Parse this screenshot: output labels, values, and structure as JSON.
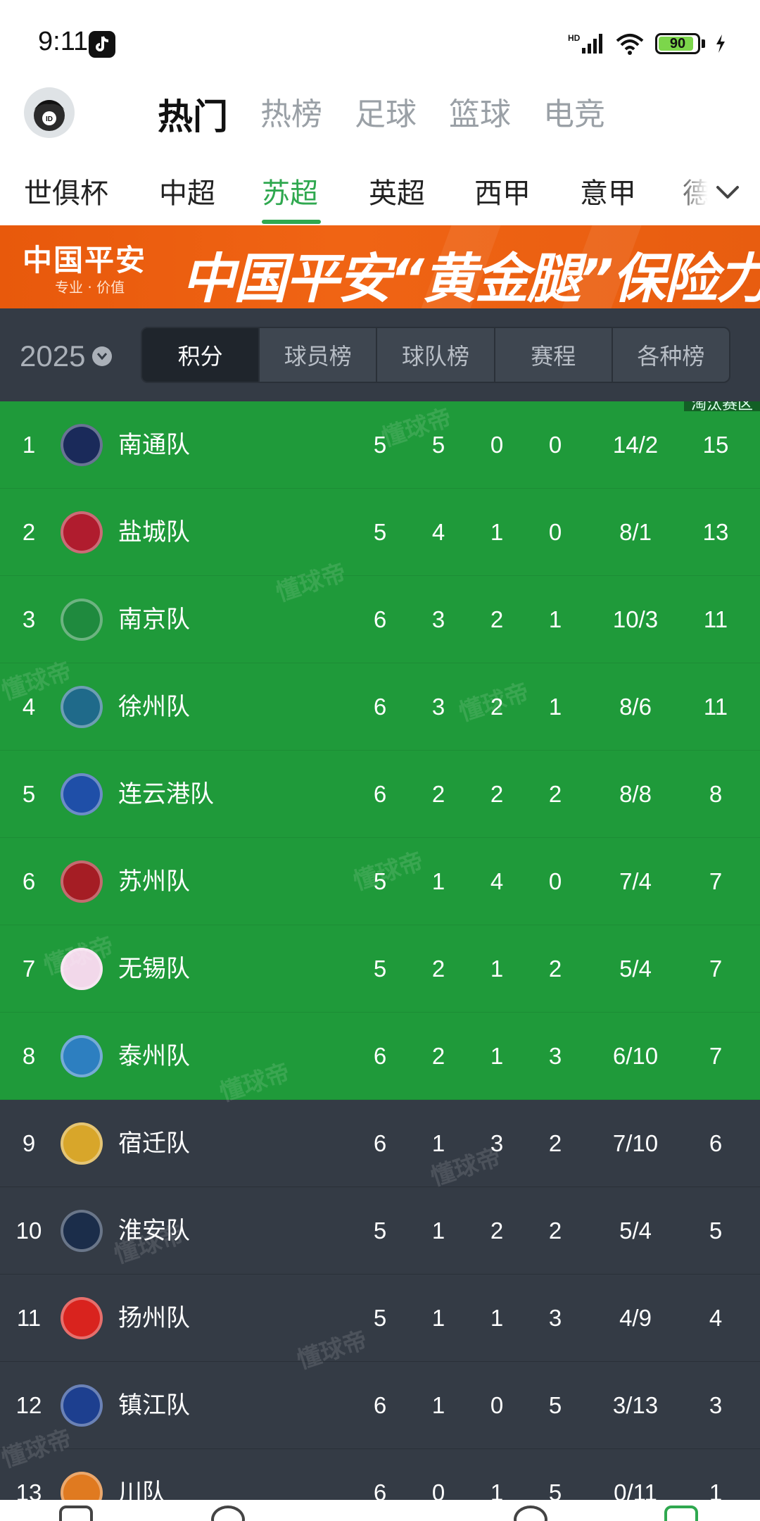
{
  "status_bar": {
    "time": "9:11",
    "battery": "90",
    "battery_level": 0.9
  },
  "top_nav": {
    "tabs": [
      "热门",
      "热榜",
      "足球",
      "篮球",
      "电竞"
    ],
    "active_index": 0
  },
  "league_tabs": {
    "items": [
      "世俱杯",
      "中超",
      "苏超",
      "英超",
      "西甲",
      "意甲",
      "德"
    ],
    "active_index": 2
  },
  "banner": {
    "brand": "中国平安",
    "sub": "专业 · 价值",
    "slogan": "中国平安“黄金腿”保险力挺苏超"
  },
  "filter": {
    "year": "2025",
    "segments": [
      "积分",
      "球员榜",
      "球队榜",
      "赛程",
      "各种榜"
    ],
    "active_index": 0
  },
  "zone_tag": "淘汰赛区",
  "watermark": "懂球帝",
  "standings": [
    {
      "rank": "1",
      "team": "南通队",
      "played": "5",
      "win": "5",
      "draw": "0",
      "loss": "0",
      "goals": "14/2",
      "points": "15",
      "zone": "green",
      "logo_color": "#1a2a5a"
    },
    {
      "rank": "2",
      "team": "盐城队",
      "played": "5",
      "win": "4",
      "draw": "1",
      "loss": "0",
      "goals": "8/1",
      "points": "13",
      "zone": "green",
      "logo_color": "#b01c2e"
    },
    {
      "rank": "3",
      "team": "南京队",
      "played": "6",
      "win": "3",
      "draw": "2",
      "loss": "1",
      "goals": "10/3",
      "points": "11",
      "zone": "green",
      "logo_color": "#1f8a3e"
    },
    {
      "rank": "4",
      "team": "徐州队",
      "played": "6",
      "win": "3",
      "draw": "2",
      "loss": "1",
      "goals": "8/6",
      "points": "11",
      "zone": "green",
      "logo_color": "#1f6a8a"
    },
    {
      "rank": "5",
      "team": "连云港队",
      "played": "6",
      "win": "2",
      "draw": "2",
      "loss": "2",
      "goals": "8/8",
      "points": "8",
      "zone": "green",
      "logo_color": "#1f4fa8"
    },
    {
      "rank": "6",
      "team": "苏州队",
      "played": "5",
      "win": "1",
      "draw": "4",
      "loss": "0",
      "goals": "7/4",
      "points": "7",
      "zone": "green",
      "logo_color": "#a51d24"
    },
    {
      "rank": "7",
      "team": "无锡队",
      "played": "5",
      "win": "2",
      "draw": "1",
      "loss": "2",
      "goals": "5/4",
      "points": "7",
      "zone": "green",
      "logo_color": "#f2d8ea"
    },
    {
      "rank": "8",
      "team": "泰州队",
      "played": "6",
      "win": "2",
      "draw": "1",
      "loss": "3",
      "goals": "6/10",
      "points": "7",
      "zone": "green",
      "logo_color": "#2d7fc0"
    },
    {
      "rank": "9",
      "team": "宿迁队",
      "played": "6",
      "win": "1",
      "draw": "3",
      "loss": "2",
      "goals": "7/10",
      "points": "6",
      "zone": "dark",
      "logo_color": "#d8a62a"
    },
    {
      "rank": "10",
      "team": "淮安队",
      "played": "5",
      "win": "1",
      "draw": "2",
      "loss": "2",
      "goals": "5/4",
      "points": "5",
      "zone": "dark",
      "logo_color": "#1b2d4a"
    },
    {
      "rank": "11",
      "team": "扬州队",
      "played": "5",
      "win": "1",
      "draw": "1",
      "loss": "3",
      "goals": "4/9",
      "points": "4",
      "zone": "dark",
      "logo_color": "#d9231e"
    },
    {
      "rank": "12",
      "team": "镇江队",
      "played": "6",
      "win": "1",
      "draw": "0",
      "loss": "5",
      "goals": "3/13",
      "points": "3",
      "zone": "dark",
      "logo_color": "#1d3f8f"
    },
    {
      "rank": "13",
      "team": "川队",
      "played": "6",
      "win": "0",
      "draw": "1",
      "loss": "5",
      "goals": "0/11",
      "points": "1",
      "zone": "dark",
      "logo_color": "#e07a20"
    }
  ]
}
